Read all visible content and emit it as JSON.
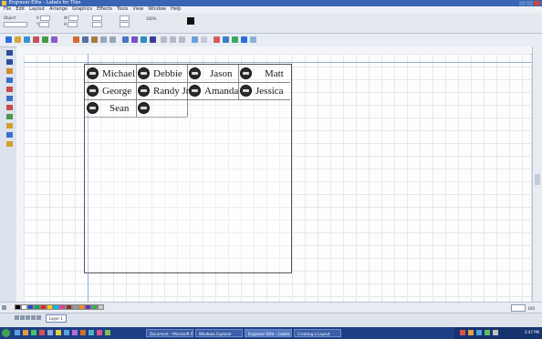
{
  "window": {
    "title": "Engraver Elite – Labels for Tiles"
  },
  "menu": [
    "File",
    "Edit",
    "Layout",
    "Arrange",
    "Graphics",
    "Effects",
    "Tools",
    "View",
    "Window",
    "Help"
  ],
  "propbar": {
    "obj_label": "Object",
    "x_label": "X",
    "y_label": "Y",
    "w_label": "W",
    "h_label": "H",
    "zoom_label": "100%"
  },
  "labels": [
    {
      "text": "Michael"
    },
    {
      "text": "Debbie"
    },
    {
      "text": "Jason"
    },
    {
      "text": "Matt"
    },
    {
      "text": "George"
    },
    {
      "text": "Randy Jr."
    },
    {
      "text": "Amanda"
    },
    {
      "text": "Jessica"
    },
    {
      "text": "Sean"
    },
    {
      "text": ""
    }
  ],
  "pagebar": {
    "tab": "Layer 1"
  },
  "status": {
    "zoom": "100"
  },
  "taskbar": {
    "tasks": [
      "Document – Microsoft W...",
      "Windows Explorer",
      "Engraver Elite – Labels",
      "Creating a Layout"
    ],
    "clock": "3:47 PM"
  },
  "colors": {
    "palette": [
      "#000000",
      "#ffffff",
      "#1f4fd1",
      "#00a650",
      "#e02b2b",
      "#ffd200",
      "#00b7e8",
      "#e23ea0",
      "#7a3c1d",
      "#999999",
      "#f28c28",
      "#6c2fa6",
      "#2fb25a",
      "#c8c8c8"
    ],
    "taskbar": "#1e3f86",
    "titlebar": "#3a64b4"
  }
}
